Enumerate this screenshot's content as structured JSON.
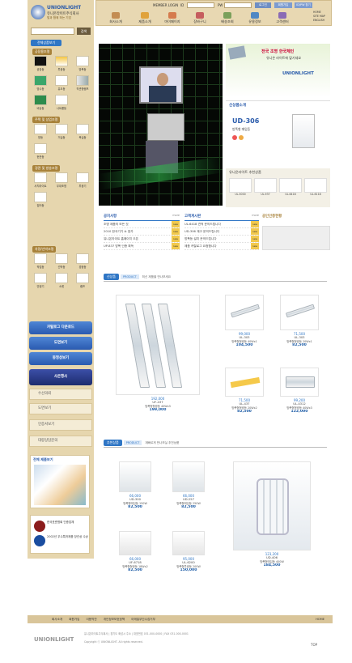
{
  "brand": {
    "name_en": "UNIONLIGHT",
    "name_ko": "유니온라이트주식회사",
    "tagline": "빛과 함께 하는 기업"
  },
  "login": {
    "member_login": "MEMBER LOGIN",
    "id_label": "ID",
    "pw_label": "PW",
    "login_btn": "로그인",
    "join": "회원가입",
    "find": "ID/PW 찾기"
  },
  "util": {
    "home": "HOME",
    "sitemap": "SITE MAP",
    "english": "ENGLISH"
  },
  "nav": [
    {
      "label": "회사소개",
      "color": "#c38c52"
    },
    {
      "label": "제품소개",
      "color": "#e0a23b"
    },
    {
      "label": "마이페이지",
      "color": "#d57b4d"
    },
    {
      "label": "장바구니",
      "color": "#c65e5e"
    },
    {
      "label": "배송조회",
      "color": "#7ba05b"
    },
    {
      "label": "유용정보",
      "color": "#4f88c4"
    },
    {
      "label": "고객센터",
      "color": "#8a6bb5"
    }
  ],
  "search": {
    "placeholder": "",
    "button": "검색"
  },
  "sidebar": {
    "header": "전체상품보기",
    "categories": [
      {
        "label": "공장용조명",
        "items": [
          "공장등",
          "투광등",
          "방폭등",
          "방수등",
          "유도등",
          "직관형램프",
          "비상등",
          "나트륨등"
        ]
      },
      {
        "label": "사무실/공공조명",
        "items": [
          "매입등",
          "트라이등",
          "사각등",
          "벽부등",
          "펜던트"
        ]
      },
      {
        "label": "주택 및 상업조명",
        "items": [
          "방등",
          "거실등",
          "욕실등",
          "현관등"
        ]
      },
      {
        "label": "경관 및 방송조명",
        "items": [
          "서치라이트",
          "무대조명",
          "투광기",
          "집어등"
        ]
      },
      {
        "label": "차량/선박조명",
        "items": [
          "작업등",
          "선박등",
          "경광등"
        ]
      },
      {
        "label": "부품/악세사리",
        "items": [
          "안정기",
          "소켓",
          "램프"
        ]
      }
    ],
    "banners": [
      {
        "label": "카탈로그 다운로드",
        "sub": "CATALOG"
      },
      {
        "label": "도면보기",
        "sub": "DRAWING"
      },
      {
        "label": "동영상보기",
        "sub": "MOVIE"
      },
      {
        "label": "사은행사",
        "sub": "EVENT"
      }
    ],
    "menus": [
      "수선의뢰",
      "도면보기",
      "인증서보기",
      "대량상담문의"
    ],
    "product_photo_title": "전체 제품보기",
    "award_text": "2002년 우수특허제품 장관상 수상",
    "award_title": "한국표준협회 인증업체"
  },
  "main_visual": {
    "caption": ""
  },
  "side_banner": {
    "headline": "전국 조명 한국체인",
    "sub": "유니온 라이트에 맡기세요",
    "hotline": "UNIONLIGHT",
    "new_label": "신상품소개",
    "model": "UD-306",
    "model_desc": "방폭형 매입등"
  },
  "recommend": {
    "title": "유니온라이트 추천상품",
    "items": [
      "UL-5000",
      "UL-937",
      "UL-6418",
      "UL-6118"
    ]
  },
  "notice": {
    "title": "공지사항",
    "more": "more",
    "items": [
      {
        "text": "조명 제품의 모든 것",
        "tag": "new"
      },
      {
        "text": "2010 한국기기 쇼 참가",
        "tag": "new"
      },
      {
        "text": "유니온라이트 홈페이지 오픈",
        "tag": "new"
      },
      {
        "text": "UP-837 방폭 인증 획득",
        "tag": "new"
      }
    ]
  },
  "qna": {
    "title": "고객게시판",
    "more": "more",
    "items": [
      {
        "text": "UL-6418 견적 문의드립니다",
        "tag": "new"
      },
      {
        "text": "UD-306 재고 문의드립니다",
        "tag": "new"
      },
      {
        "text": "방폭등 설치 문의드립니다",
        "tag": "new"
      },
      {
        "text": "제품 카탈로그 요청합니다",
        "tag": "new"
      }
    ]
  },
  "cert": {
    "title": "공인인증현황"
  },
  "new_products": {
    "tag": "신상품",
    "tag_en": "PRODUCT",
    "sub": "최신 제품을 만나보세요",
    "items": [
      {
        "price": "192,000",
        "model": "UF-437",
        "desc": "방폭형형광등 40Wx3",
        "sale": "199,000"
      },
      {
        "price": "99,000",
        "model": "UL-303",
        "desc": "방폭형형광등 40Wx1",
        "sale": "104,500"
      },
      {
        "price": "71,500",
        "model": "UL-303",
        "desc": "방폭형형광등 20Wx1",
        "sale": "82,500"
      },
      {
        "price": "71,500",
        "model": "UL-437",
        "desc": "방폭형형광등 20Wx2",
        "sale": "82,500"
      },
      {
        "price": "99,200",
        "model": "UL-4312",
        "desc": "방폭형형광등 40Wx3",
        "sale": "122,000"
      }
    ]
  },
  "rec_products": {
    "tag": "추천상품",
    "tag_en": "PRODUCT",
    "sub": "재빠르게 만나보실 추천상품",
    "items": [
      {
        "price": "66,000",
        "model": "UD-300",
        "desc": "방폭형매입등 150W",
        "sale": "82,500"
      },
      {
        "price": "66,000",
        "model": "UD-257",
        "desc": "방폭형매입등 250W",
        "sale": "82,500"
      },
      {
        "price": "123,200",
        "model": "UD-406",
        "desc": "방폭형매입등 400W",
        "sale": "184,500"
      },
      {
        "price": "66,000",
        "model": "UF-6718",
        "desc": "방폭형형광등 18Wx2",
        "sale": "82,500"
      },
      {
        "price": "95,000",
        "model": "UL-6200",
        "desc": "방폭형투광등 200W",
        "sale": "150,000"
      }
    ]
  },
  "footer": {
    "links": [
      "회사소개",
      "회원가입",
      "이용약관",
      "개인정보보호정책",
      "이메일무단수집거부",
      "HOME"
    ],
    "address": "유니온라이트주식회사 | 경기도 화성시 주소 | 대표번호 031-000-0000 | FAX 031-000-0001",
    "copyright": "Copyright ⓒ UNIONLIGHT. All rights reserved.",
    "top": "TOP"
  },
  "colors": {
    "accent": "#2f76c5",
    "brand": "#2a5bab",
    "gold": "#a8823a",
    "sidebar_bg": "#e6d6ae"
  }
}
